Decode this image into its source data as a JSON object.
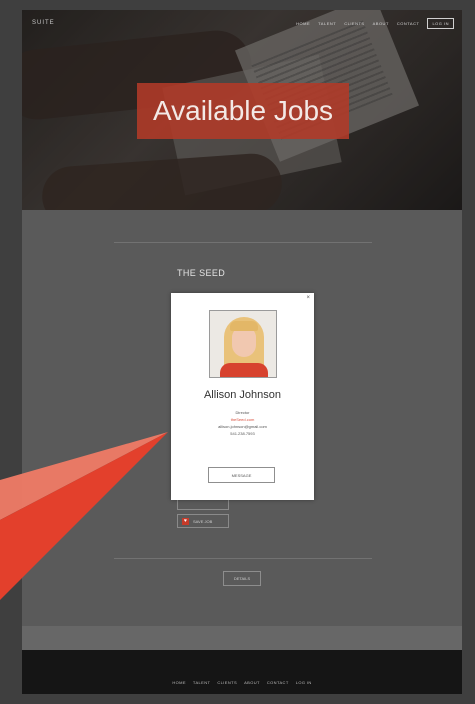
{
  "site": {
    "logo": "SUITE",
    "nav": [
      "HOME",
      "TALENT",
      "CLIENTS",
      "ABOUT",
      "CONTACT"
    ],
    "nav_login": "LOG IN",
    "hero_title": "Available Jobs"
  },
  "job": {
    "title": "THE SEED",
    "button_partial": "",
    "button_save": "SAVE JOB",
    "details_button": "DETAILS"
  },
  "modal": {
    "close": "×",
    "name": "Allison Johnson",
    "role": "Director",
    "company": "theSeed.com",
    "email": "allison.johnson@gmail.com",
    "phone": "541.238.7593",
    "message_button": "MESSAGE"
  },
  "footer": {
    "nav": [
      "HOME",
      "TALENT",
      "CLIENTS",
      "ABOUT",
      "CONTACT",
      "LOG IN"
    ]
  },
  "colors": {
    "accent": "#c63b2a",
    "arrow_light": "#f07b66",
    "arrow_dark": "#e3402c"
  }
}
